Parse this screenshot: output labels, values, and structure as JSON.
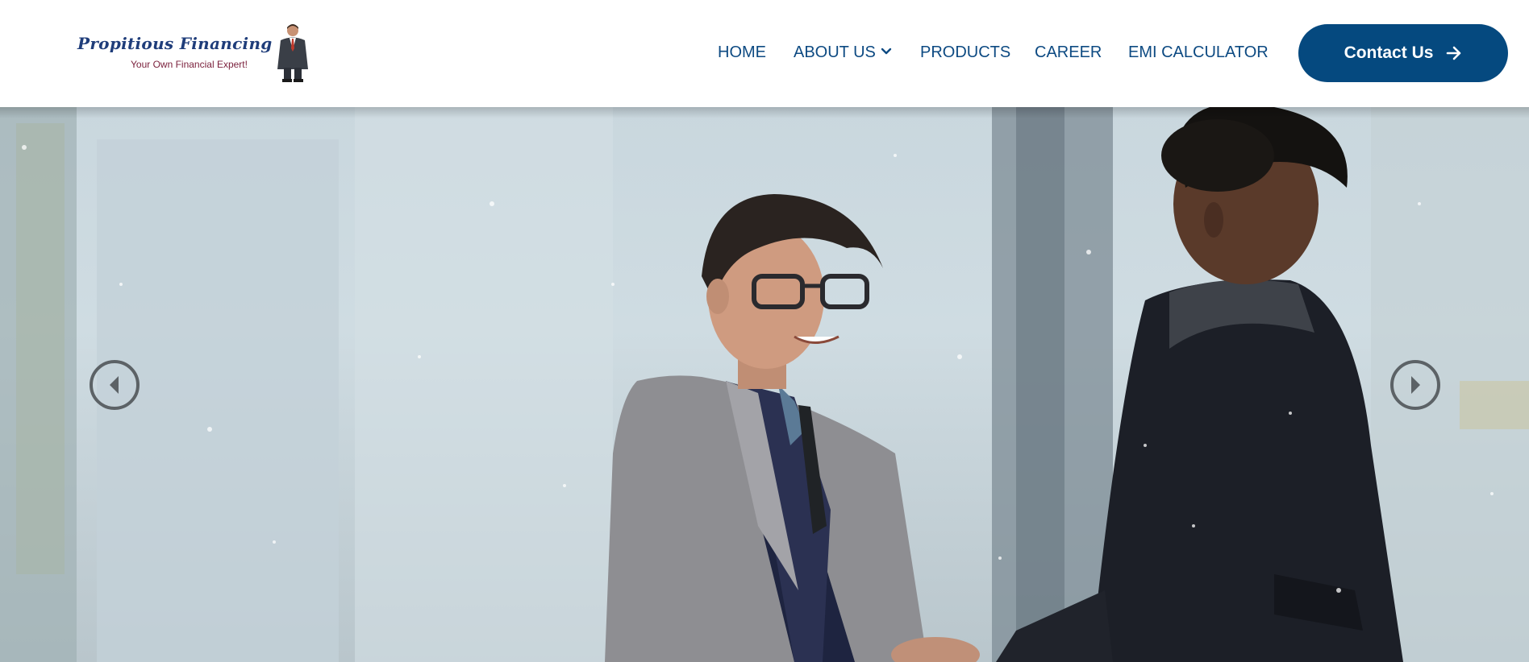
{
  "logo": {
    "title": "Propitious Financing",
    "tagline": "Your Own Financial Expert!"
  },
  "nav": {
    "items": [
      {
        "label": "HOME"
      },
      {
        "label": "ABOUT US",
        "has_dropdown": true
      },
      {
        "label": "PRODUCTS"
      },
      {
        "label": "CAREER"
      },
      {
        "label": "EMI CALCULATOR"
      }
    ]
  },
  "contact_button": {
    "label": "Contact Us",
    "icon": "arrow-right-icon"
  },
  "hero": {
    "image_alt": "Two businessmen shaking hands outdoors in snow",
    "prev_icon": "chevron-left-icon",
    "next_icon": "chevron-right-icon"
  },
  "colors": {
    "brand_navy": "#05497f",
    "nav_text": "#0d4a82",
    "arrow_gray": "#5c6266"
  }
}
